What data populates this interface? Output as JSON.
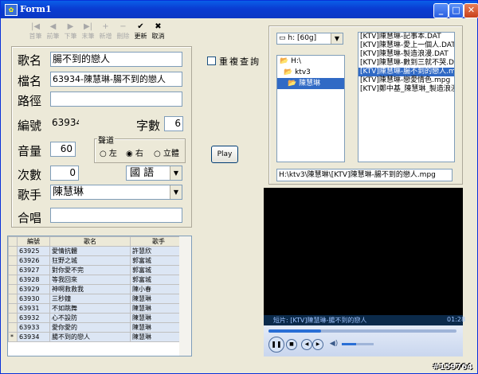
{
  "window": {
    "title": "Form1",
    "min": "_",
    "max": "□",
    "close": "✕"
  },
  "toolbar": [
    {
      "glyph": "|◀",
      "label": "首筆",
      "enabled": false
    },
    {
      "glyph": "◀",
      "label": "前筆",
      "enabled": false
    },
    {
      "glyph": "▶",
      "label": "下筆",
      "enabled": false
    },
    {
      "glyph": "▶|",
      "label": "末筆",
      "enabled": false
    },
    {
      "glyph": "+",
      "label": "新增",
      "enabled": false
    },
    {
      "glyph": "−",
      "label": "刪除",
      "enabled": false
    },
    {
      "glyph": "✔",
      "label": "更新",
      "enabled": true
    },
    {
      "glyph": "✖",
      "label": "取消",
      "enabled": true
    }
  ],
  "form": {
    "song_label": "歌名",
    "song_value": "腸不到的戀人",
    "file_label": "檔名",
    "file_value": "63934-陳慧琳-腸不到的戀人",
    "path_label": "路徑",
    "path_value": "",
    "id_label": "編號",
    "id_value": "63934",
    "words_label": "字數",
    "words_value": "6",
    "volume_label": "音量",
    "volume_value": "60",
    "channel_label": "聲道",
    "channel_left": "左",
    "channel_right": "右",
    "channel_stereo": "立體",
    "count_label": "次數",
    "count_value": "0",
    "language_value": "國 語",
    "singer_label": "歌手",
    "singer_value": "陳慧琳",
    "chorus_label": "合唱",
    "chorus_value": ""
  },
  "repeat_check_label": "重複查詢",
  "play_button": "Play",
  "drive": {
    "value": "h: [60g]"
  },
  "folders": [
    "H:\\",
    "ktv3",
    "陳慧琳"
  ],
  "files": [
    "[KTV]陳慧琳-記事本.DAT",
    "[KTV]陳慧琳-愛上一個人.DAT",
    "[KTV]陳慧琳-製造浪漫.DAT",
    "[KTV]陳慧琳-數到三就不哭.DAT",
    "[KTV]陳慧琳-腸不到的戀人.mpg",
    "[KTV]陳慧琳-戀愛情色.mpg",
    "[KTV]鄭中基_陳慧琳_製造浪漫"
  ],
  "selected_file_index": 4,
  "full_path": "H:\\ktv3\\陳慧琳\\[KTV]陳慧琳-腸不到的戀人.mpg",
  "grid": {
    "headers": [
      "編號",
      "歌名",
      "歌手"
    ],
    "rows": [
      [
        "63925",
        "愛情抗體",
        "許慧欣"
      ],
      [
        "63926",
        "狂野之城",
        "郭富城"
      ],
      [
        "63927",
        "對你愛不完",
        "郭富城"
      ],
      [
        "63928",
        "等我回來",
        "郭富城"
      ],
      [
        "63929",
        "神啊救救我",
        "陳小春"
      ],
      [
        "63930",
        "三秒鐘",
        "陳慧琳"
      ],
      [
        "63931",
        "不如跳舞",
        "陳慧琳"
      ],
      [
        "63932",
        "心不設防",
        "陳慧琳"
      ],
      [
        "63933",
        "愛你愛的",
        "陳慧琳"
      ],
      [
        "63934",
        "腸不到的戀人",
        "陳慧琳"
      ]
    ],
    "current_row_marker": "*"
  },
  "player": {
    "caption": "短片: [KTV]陳慧琳-腸不到的戀人",
    "time": "01:28",
    "progress": 0.28,
    "volume": 0.45
  },
  "watermark": "#159764",
  "colors": {
    "selection": "#316ac5",
    "grid_row": "#dce6f4",
    "title_bar": "#0a3cd2"
  }
}
